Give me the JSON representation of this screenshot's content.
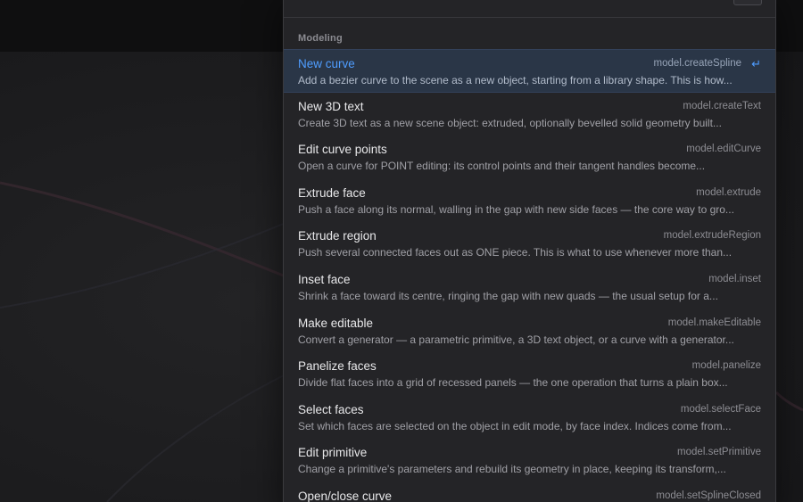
{
  "section": {
    "label": "Modeling"
  },
  "enter_icon": "↵",
  "items": [
    {
      "title": "New curve",
      "command": "model.createSpline",
      "description": "Add a bezier curve to the scene as a new object, starting from a library shape. This is how..."
    },
    {
      "title": "New 3D text",
      "command": "model.createText",
      "description": "Create 3D text as a new scene object: extruded, optionally bevelled solid geometry built..."
    },
    {
      "title": "Edit curve points",
      "command": "model.editCurve",
      "description": "Open a curve for POINT editing: its control points and their tangent handles become..."
    },
    {
      "title": "Extrude face",
      "command": "model.extrude",
      "description": "Push a face along its normal, walling in the gap with new side faces — the core way to gro..."
    },
    {
      "title": "Extrude region",
      "command": "model.extrudeRegion",
      "description": "Push several connected faces out as ONE piece. This is what to use whenever more than..."
    },
    {
      "title": "Inset face",
      "command": "model.inset",
      "description": "Shrink a face toward its centre, ringing the gap with new quads — the usual setup for a..."
    },
    {
      "title": "Make editable",
      "command": "model.makeEditable",
      "description": "Convert a generator — a parametric primitive, a 3D text object, or a curve with a generator..."
    },
    {
      "title": "Panelize faces",
      "command": "model.panelize",
      "description": "Divide flat faces into a grid of recessed panels — the one operation that turns a plain box..."
    },
    {
      "title": "Select faces",
      "command": "model.selectFace",
      "description": "Set which faces are selected on the object in edit mode, by face index. Indices come from..."
    },
    {
      "title": "Edit primitive",
      "command": "model.setPrimitive",
      "description": "Change a primitive's parameters and rebuild its geometry in place, keeping its transform,..."
    },
    {
      "title": "Open/close curve",
      "command": "model.setSplineClosed",
      "description": ""
    }
  ],
  "colors": {
    "selected_bg": "#2a3647",
    "accent": "#4f9dff",
    "palette_bg": "#242427"
  }
}
